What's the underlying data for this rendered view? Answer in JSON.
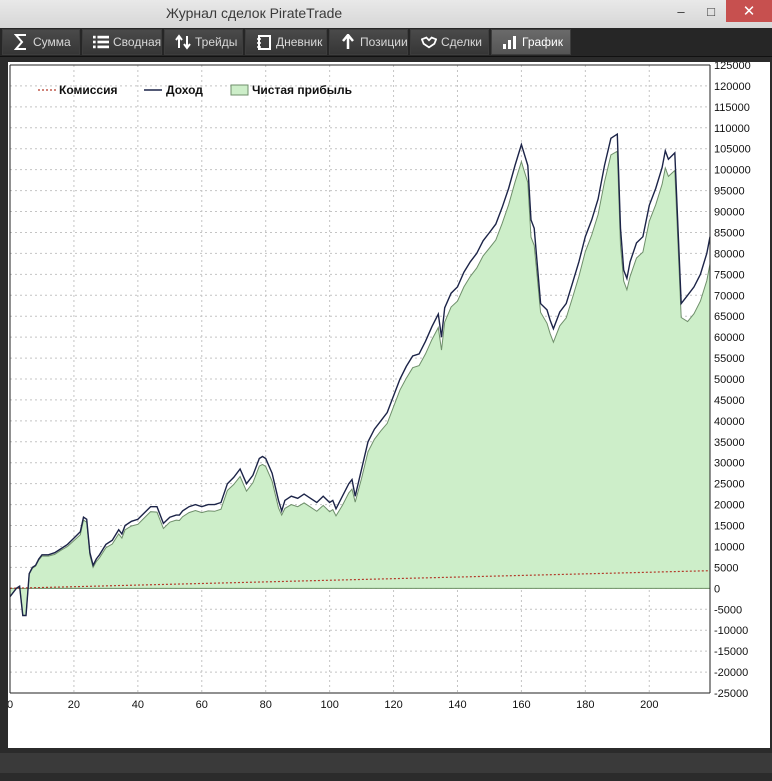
{
  "window": {
    "title": "Журнал сделок PirateTrade",
    "minimize": "–",
    "maximize": "□",
    "close": "✕"
  },
  "tabs": [
    {
      "label": "Сумма",
      "icon": "sigma-icon",
      "active": false
    },
    {
      "label": "Сводная",
      "icon": "list-icon",
      "active": false
    },
    {
      "label": "Трейды",
      "icon": "swap-arrows-icon",
      "active": false
    },
    {
      "label": "Дневник",
      "icon": "notebook-icon",
      "active": false
    },
    {
      "label": "Позиции",
      "icon": "arrow-up-icon",
      "active": false
    },
    {
      "label": "Сделки",
      "icon": "handshake-icon",
      "active": false
    },
    {
      "label": "График",
      "icon": "bar-chart-icon",
      "active": true
    }
  ],
  "colors": {
    "net_profit_fill": "#cdeec9",
    "net_profit_line": "#6f8f6b",
    "income_line": "#1c2448",
    "commission_line": "#b33a2a"
  },
  "chart_data": {
    "type": "area",
    "legend": [
      "Комиссия",
      "Доход",
      "Чистая прибыль"
    ],
    "legend_position": "top-left",
    "grid": true,
    "xlim": [
      0,
      219
    ],
    "ylim": [
      -25000,
      125000
    ],
    "x_ticks": [
      0,
      20,
      40,
      60,
      80,
      100,
      120,
      140,
      160,
      180,
      200
    ],
    "y_ticks": [
      125000,
      120000,
      115000,
      110000,
      105000,
      100000,
      95000,
      90000,
      85000,
      80000,
      75000,
      70000,
      65000,
      60000,
      55000,
      50000,
      45000,
      40000,
      35000,
      30000,
      25000,
      20000,
      15000,
      10000,
      5000,
      0,
      -5000,
      -10000,
      -15000,
      -20000,
      -25000
    ],
    "y_axis_side": "right",
    "series": [
      {
        "name": "Доход",
        "x": [
          0,
          2,
          3,
          4,
          5,
          6,
          7,
          8,
          9,
          10,
          12,
          14,
          16,
          18,
          20,
          22,
          23,
          24,
          25,
          26,
          27,
          28,
          30,
          32,
          34,
          35,
          36,
          38,
          40,
          42,
          44,
          46,
          48,
          50,
          52,
          53,
          54,
          56,
          58,
          60,
          62,
          64,
          66,
          68,
          70,
          72,
          74,
          76,
          78,
          79,
          80,
          82,
          84,
          85,
          86,
          88,
          90,
          92,
          94,
          96,
          98,
          100,
          101,
          102,
          104,
          106,
          107,
          108,
          110,
          112,
          114,
          116,
          118,
          120,
          122,
          124,
          126,
          128,
          130,
          132,
          134,
          135,
          136,
          138,
          140,
          142,
          144,
          146,
          148,
          150,
          152,
          154,
          156,
          158,
          160,
          162,
          163,
          164,
          166,
          168,
          169,
          170,
          172,
          174,
          176,
          178,
          180,
          182,
          184,
          186,
          188,
          190,
          191,
          192,
          193,
          194,
          196,
          198,
          200,
          202,
          204,
          205,
          206,
          208,
          210,
          212,
          214,
          216,
          218,
          219
        ],
        "y": [
          -2000,
          0,
          500,
          -6500,
          -6500,
          3500,
          5000,
          5500,
          7000,
          8000,
          8000,
          8500,
          9500,
          10500,
          12000,
          13500,
          17000,
          16500,
          8500,
          5500,
          7000,
          8000,
          10500,
          11500,
          14000,
          13000,
          15000,
          16000,
          16500,
          18000,
          19500,
          19500,
          15500,
          17000,
          17500,
          17500,
          18500,
          19500,
          20000,
          19500,
          20000,
          20000,
          20500,
          25000,
          26500,
          28500,
          25000,
          27000,
          31000,
          31500,
          31000,
          27500,
          21000,
          18500,
          21000,
          22000,
          21500,
          22500,
          21500,
          20500,
          22000,
          20500,
          21000,
          19000,
          22000,
          25000,
          26000,
          22000,
          28500,
          35000,
          38000,
          40000,
          42000,
          46000,
          50000,
          53000,
          55500,
          56000,
          59000,
          62500,
          65500,
          60000,
          67000,
          70500,
          72000,
          75500,
          78000,
          80000,
          83000,
          85000,
          87000,
          91000,
          95500,
          101000,
          106000,
          101000,
          88000,
          86000,
          68000,
          66500,
          64000,
          62000,
          66000,
          68000,
          73000,
          78000,
          84000,
          88000,
          93000,
          101000,
          107500,
          108500,
          86000,
          76000,
          74000,
          78000,
          82500,
          84000,
          91500,
          95500,
          100500,
          104500,
          102500,
          104000,
          68000,
          70000,
          72000,
          75000,
          80000,
          84000
        ]
      },
      {
        "name": "Чистая прибыль",
        "x": [
          0,
          2,
          3,
          4,
          5,
          6,
          7,
          8,
          9,
          10,
          12,
          14,
          16,
          18,
          20,
          22,
          23,
          24,
          25,
          26,
          27,
          28,
          30,
          32,
          34,
          35,
          36,
          38,
          40,
          42,
          44,
          46,
          48,
          50,
          52,
          53,
          54,
          56,
          58,
          60,
          62,
          64,
          66,
          68,
          70,
          72,
          74,
          76,
          78,
          79,
          80,
          82,
          84,
          85,
          86,
          88,
          90,
          92,
          94,
          96,
          98,
          100,
          101,
          102,
          104,
          106,
          107,
          108,
          110,
          112,
          114,
          116,
          118,
          120,
          122,
          124,
          126,
          128,
          130,
          132,
          134,
          135,
          136,
          138,
          140,
          142,
          144,
          146,
          148,
          150,
          152,
          154,
          156,
          158,
          160,
          162,
          163,
          164,
          166,
          168,
          169,
          170,
          172,
          174,
          176,
          178,
          180,
          182,
          184,
          186,
          188,
          190,
          191,
          192,
          193,
          194,
          196,
          198,
          200,
          202,
          204,
          205,
          206,
          208,
          210,
          212,
          214,
          216,
          218,
          219
        ],
        "y": [
          -2000,
          0,
          500,
          -6500,
          -6500,
          3400,
          4800,
          5300,
          6800,
          7700,
          7700,
          8100,
          9100,
          10000,
          11400,
          12800,
          16300,
          15800,
          7900,
          5000,
          6400,
          7300,
          9700,
          10600,
          13000,
          12000,
          14000,
          14900,
          15300,
          16800,
          18300,
          18200,
          14300,
          15800,
          16300,
          16200,
          17100,
          18100,
          18600,
          18100,
          18500,
          18400,
          18900,
          23400,
          24800,
          26700,
          23200,
          25200,
          29200,
          29600,
          29100,
          25600,
          19200,
          17500,
          19100,
          20000,
          19500,
          20400,
          19400,
          18400,
          19800,
          18300,
          18800,
          17300,
          19800,
          22800,
          23700,
          20600,
          26300,
          32600,
          35600,
          37600,
          39400,
          43400,
          47400,
          50200,
          52700,
          53200,
          56000,
          59400,
          62300,
          56900,
          63600,
          67200,
          68600,
          72000,
          74500,
          76500,
          79400,
          81300,
          83200,
          87200,
          91600,
          97000,
          101900,
          96900,
          83900,
          81900,
          65900,
          63300,
          60800,
          58800,
          62700,
          64600,
          69500,
          74500,
          80400,
          84400,
          89300,
          97100,
          103500,
          104400,
          81900,
          73400,
          71300,
          74500,
          78900,
          80300,
          87700,
          91600,
          96500,
          100400,
          98400,
          99800,
          64700,
          63700,
          65600,
          68600,
          73500,
          77500
        ]
      },
      {
        "name": "Комиссия",
        "x": [
          0,
          219
        ],
        "y": [
          0,
          4200
        ]
      }
    ]
  }
}
